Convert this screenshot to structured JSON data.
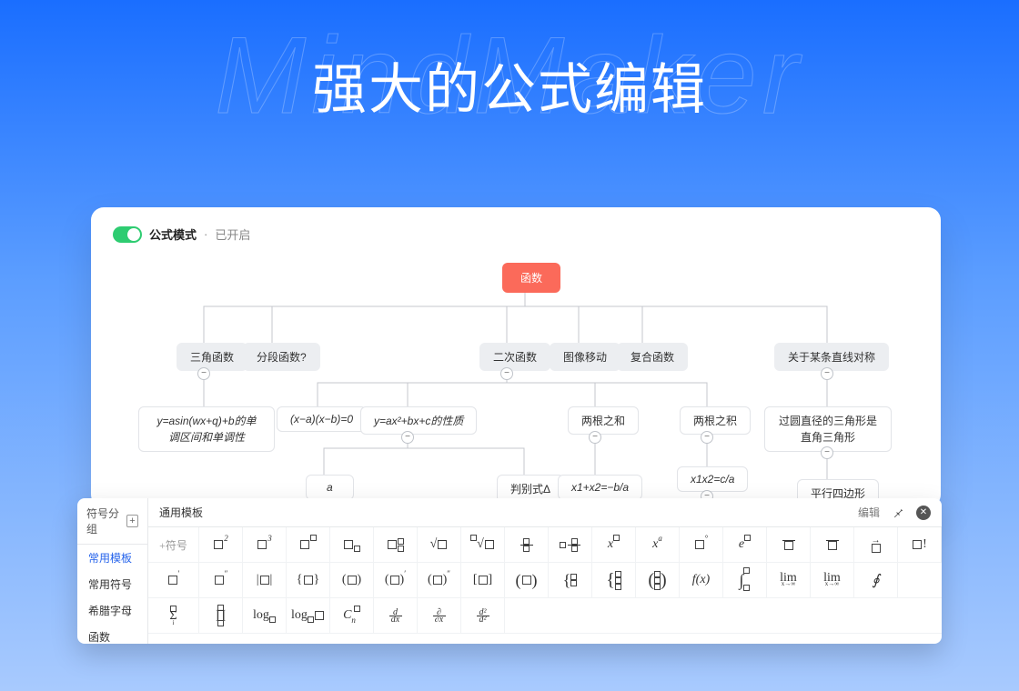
{
  "hero": {
    "watermark": "MindMaker",
    "title": "强大的公式编辑"
  },
  "modeBar": {
    "label": "公式模式",
    "separator": " · ",
    "status": "已开启"
  },
  "mindmap": {
    "root": "函数",
    "level1": [
      "三角函数",
      "分段函数?",
      "二次函数",
      "图像移动",
      "复合函数",
      "关于某条直线对称"
    ],
    "level2": {
      "n0": "y=asin(wx+q)+b的单调区间和单调性",
      "n1": "(x−a)(x−b)=0",
      "n2": "y=ax²+bx+c的性质",
      "n3": "两根之和",
      "n4": "两根之积",
      "n5": "过圆直径的三角形是直角三角形"
    },
    "level3": {
      "a": "a",
      "disc": "判别式Δ",
      "sum": "x1+x2=−b/a",
      "prod": "x1x2=c/a",
      "para": "平行四边形"
    }
  },
  "formulaPanel": {
    "sidebarTitle": "符号分组",
    "categories": [
      "常用模板",
      "常用符号",
      "希腊字母",
      "函数"
    ],
    "mainTitle": "通用模板",
    "editLabel": "编辑",
    "addSymbol": "+符号",
    "row1": [
      "□²",
      "□³",
      "□ᵃ",
      "□ₐ",
      "□ᵃₐ",
      "√□",
      "ⁿ√□",
      "□/□",
      "a□/□",
      "xᵃ",
      "xᵃ",
      "□°",
      "eᵃ",
      "ā□",
      "ā□",
      "a⃗",
      "□!"
    ],
    "row2": [
      "□′",
      "□″",
      "|□|",
      "{□}",
      "(□)",
      "(□)′",
      "(□)″",
      "[□]",
      "(□)",
      "{□}",
      "{⫶}",
      "(⫶)",
      "f(x)",
      "∫ᵇₐ",
      "lim x→∞",
      "lim x→∞",
      "∮"
    ],
    "row3": [
      "Σⁿᵢ",
      "∏",
      "logₐ",
      "logₐ□",
      "Cₙᵐ",
      "d/dx",
      "∂/∂x",
      "d²/d²"
    ]
  }
}
